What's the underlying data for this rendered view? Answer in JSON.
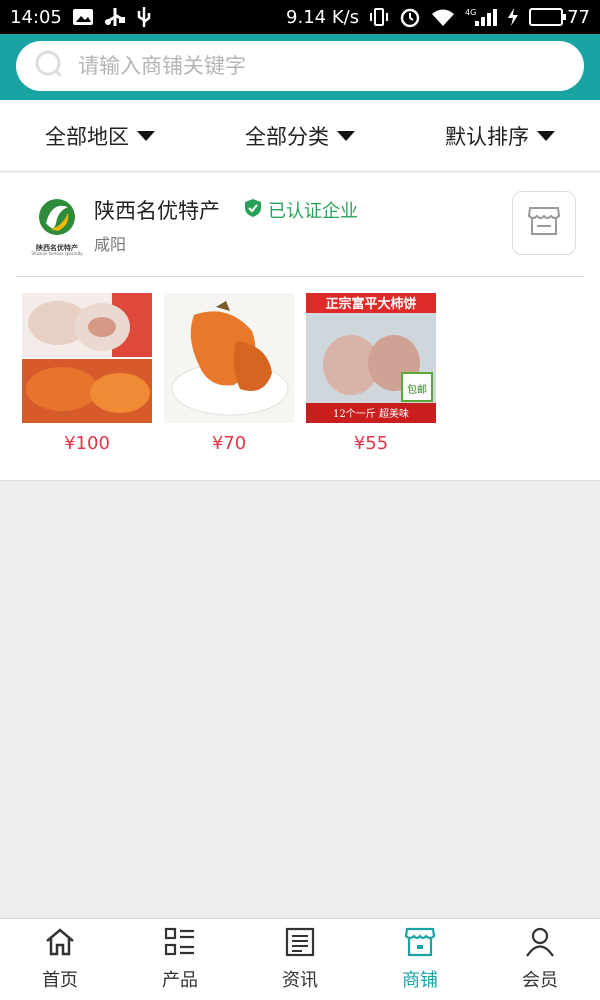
{
  "status_bar": {
    "time": "14:05",
    "speed": "9.14 K/s",
    "network": "4G",
    "battery": "77",
    "battery_level": 0.77,
    "icons": [
      "image-icon",
      "usb-icon",
      "vibrate-icon",
      "alarm-icon",
      "wifi-icon",
      "signal-icon",
      "charging-icon"
    ]
  },
  "search": {
    "placeholder": "请输入商铺关键字",
    "value": "",
    "icon": "search-icon"
  },
  "colors": {
    "brand": "#1aa3a3",
    "price": "#e0384a",
    "verified": "#2aa15a"
  },
  "filters": [
    {
      "label": "全部地区"
    },
    {
      "label": "全部分类"
    },
    {
      "label": "默认排序"
    }
  ],
  "shop": {
    "name": "陕西名优特产",
    "verified_label": "已认证企业",
    "region": "咸阳",
    "logo_text": "陕西名优特产",
    "logo_sub": "Shaanxi famous specialty",
    "products": [
      {
        "price": "¥100"
      },
      {
        "price": "¥70"
      },
      {
        "price": "¥55",
        "banner": "正宗富平大柿饼",
        "tag": "包邮",
        "caption": "12个一斤  超美味"
      }
    ]
  },
  "tabbar": {
    "tabs": [
      {
        "label": "首页",
        "icon": "home-icon"
      },
      {
        "label": "产品",
        "icon": "list-icon"
      },
      {
        "label": "资讯",
        "icon": "news-icon"
      },
      {
        "label": "商铺",
        "icon": "store-icon",
        "active": true
      },
      {
        "label": "会员",
        "icon": "user-icon"
      }
    ]
  }
}
